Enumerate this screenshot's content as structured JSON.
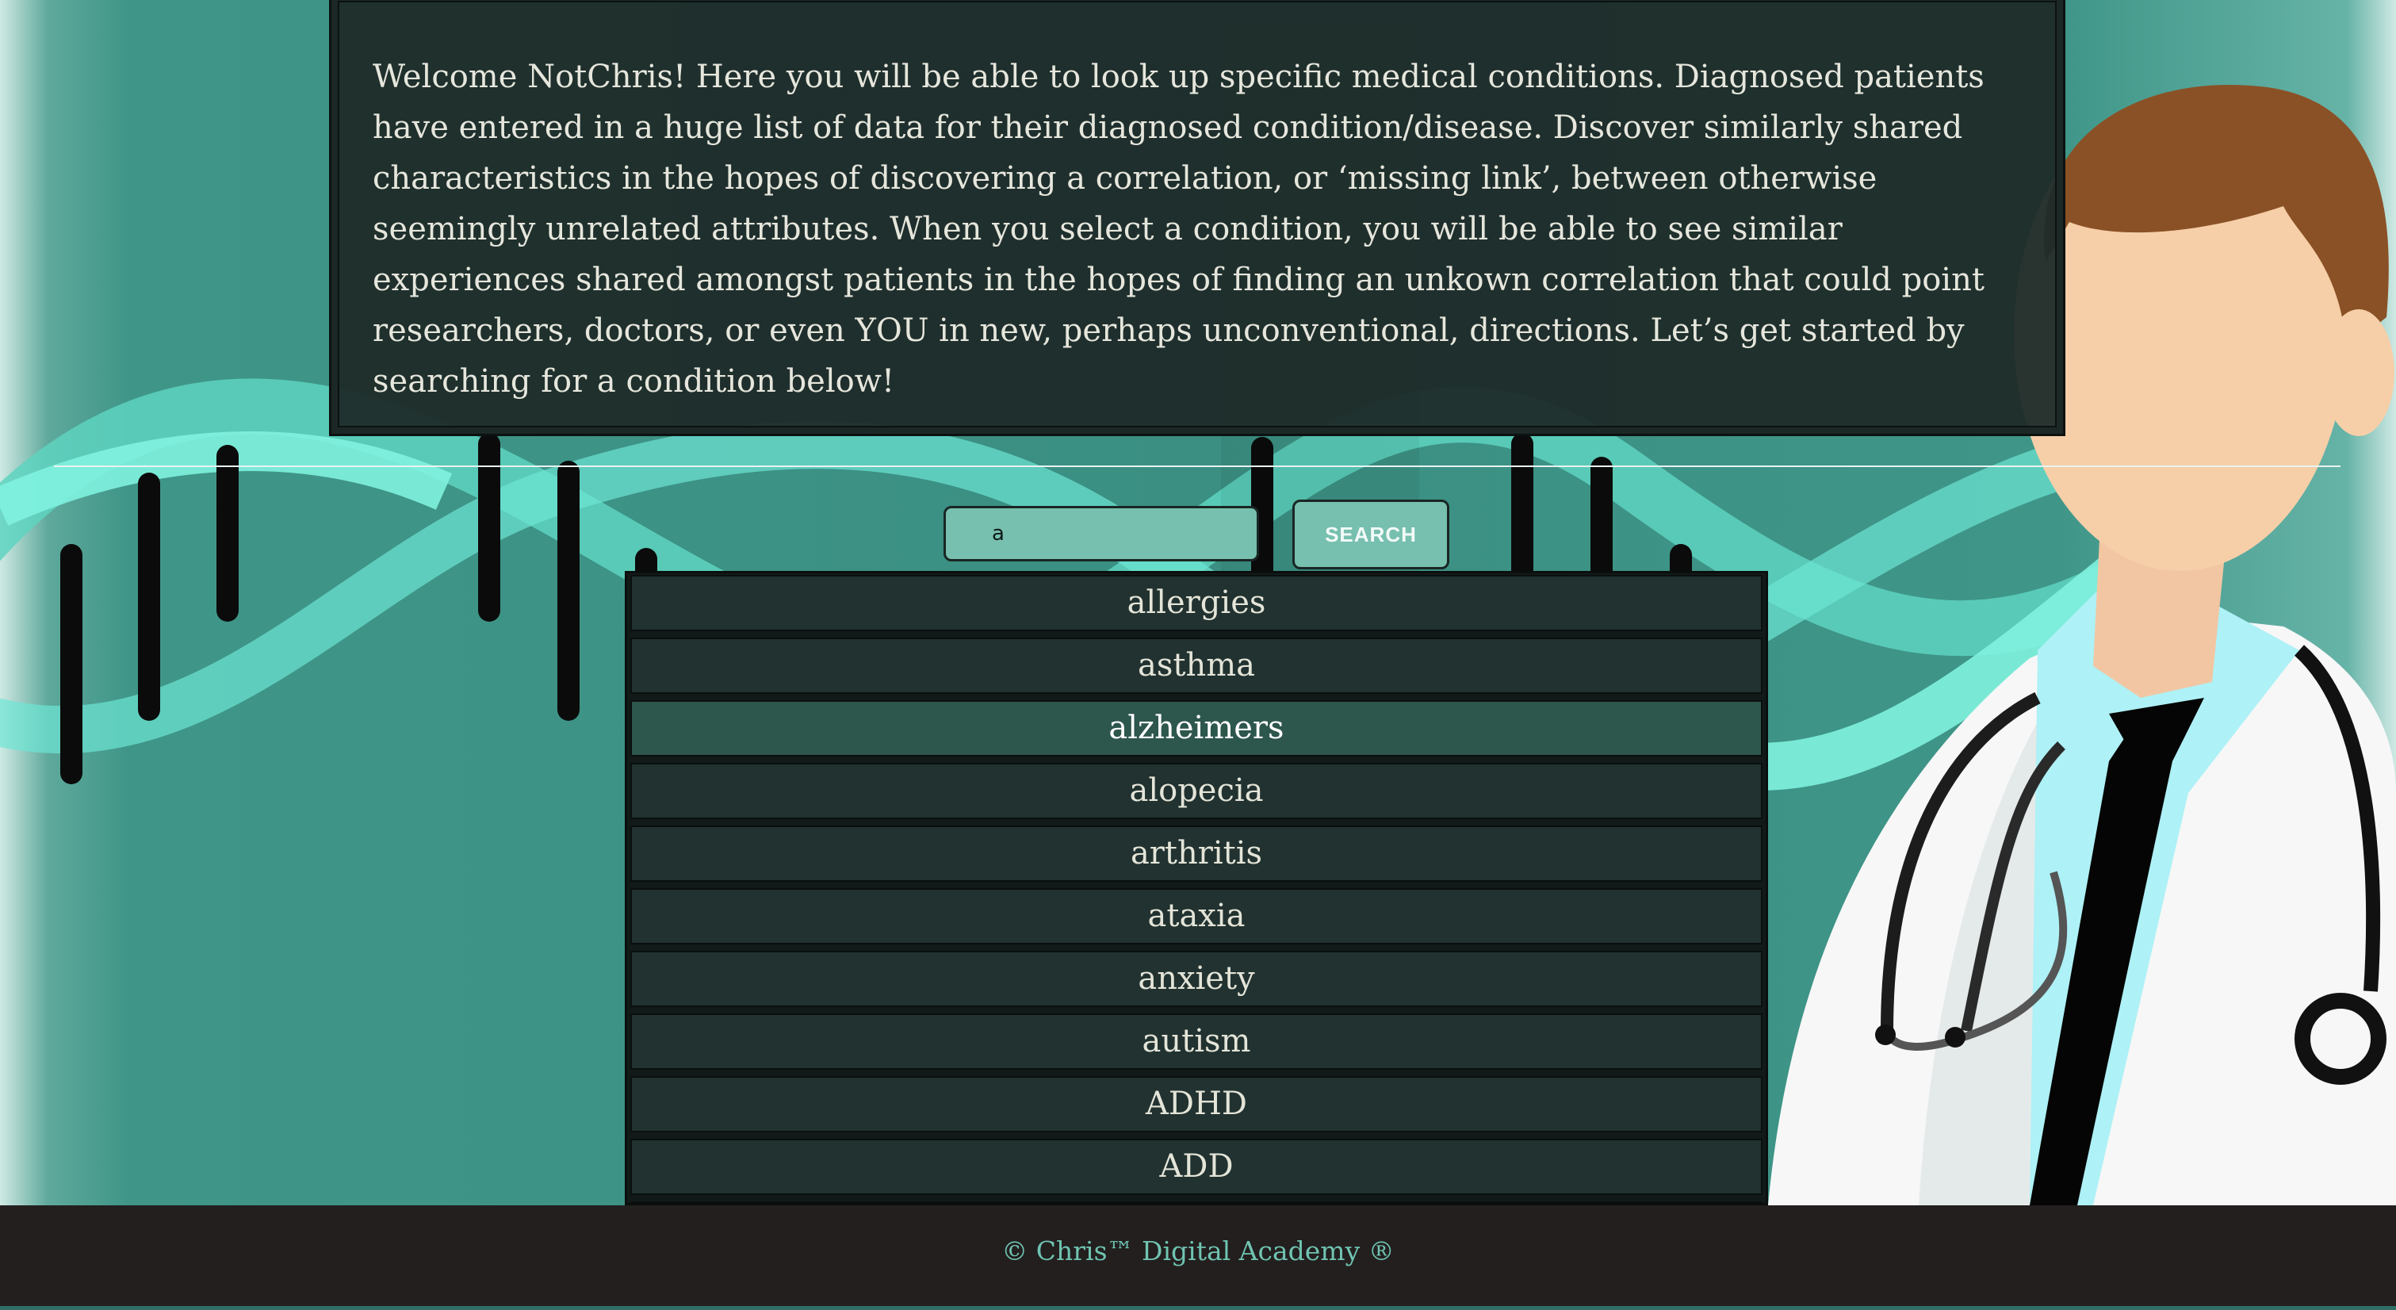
{
  "intro": {
    "text": "Welcome NotChris! Here you will be able to look up specific medical conditions. Diagnosed patients have entered in a huge list of data for their diagnosed condition/disease. Discover similarly shared characteristics in the hopes of discovering a correlation, or ‘missing link’, between otherwise seemingly unrelated attributes. When you select a condition, you will be able to see similar experiences shared amongst patients in the hopes of finding an unkown correlation that could point researchers, doctors, or even YOU in new, perhaps unconventional, directions. Let’s get started by searching for a condition below!"
  },
  "search": {
    "value": "a",
    "button_label": "SEARCH"
  },
  "results": {
    "items": [
      {
        "label": "allergies"
      },
      {
        "label": "asthma"
      },
      {
        "label": "alzheimers"
      },
      {
        "label": "alopecia"
      },
      {
        "label": "arthritis"
      },
      {
        "label": "ataxia"
      },
      {
        "label": "anxiety"
      },
      {
        "label": "autism"
      },
      {
        "label": "ADHD"
      },
      {
        "label": "ADD"
      }
    ],
    "highlighted": "alzheimers"
  },
  "footer": {
    "text": "© Chris™ Digital Academy ®"
  },
  "colors": {
    "background_teal": "#3f9688",
    "panel_dark": "#1e2a28",
    "accent_teal": "#77bfae",
    "footer_text": "#6fc4b1",
    "footer_bg": "#231f1f"
  }
}
